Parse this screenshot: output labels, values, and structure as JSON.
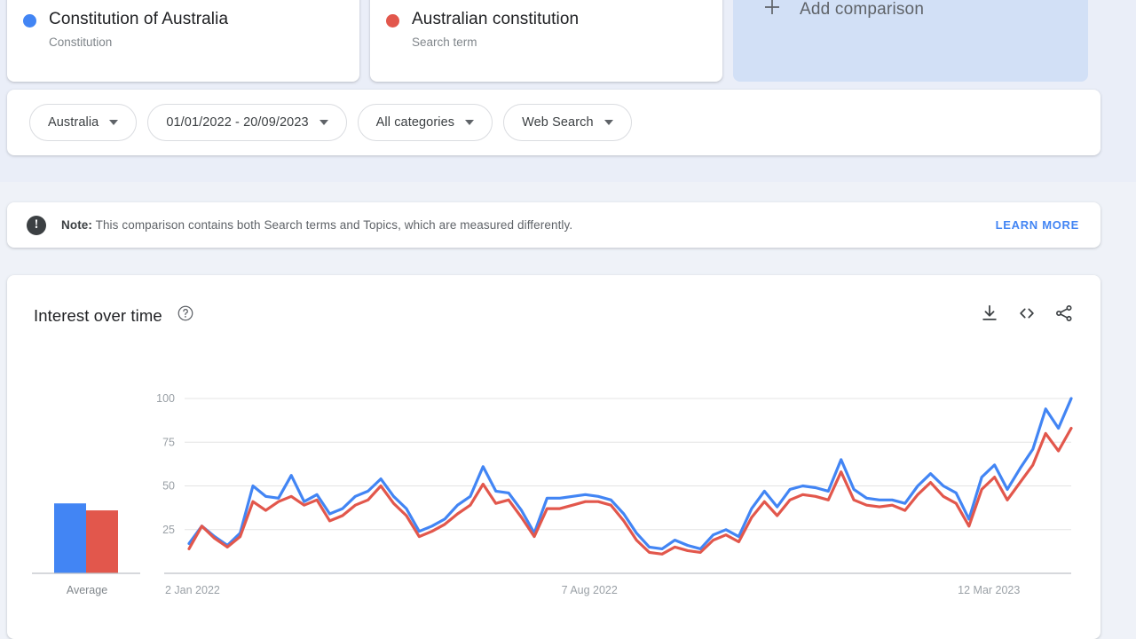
{
  "terms": [
    {
      "title": "Constitution of Australia",
      "subtitle": "Constitution",
      "color": "#4285f4",
      "dot_name": "legend-dot-blue"
    },
    {
      "title": "Australian constitution",
      "subtitle": "Search term",
      "color": "#e2574c",
      "dot_name": "legend-dot-red"
    }
  ],
  "add_comparison": {
    "label": "Add comparison",
    "icon": "plus-icon"
  },
  "filters": [
    {
      "label": "Australia",
      "name": "region-filter"
    },
    {
      "label": "01/01/2022 - 20/09/2023",
      "name": "date-range-filter"
    },
    {
      "label": "All categories",
      "name": "category-filter"
    },
    {
      "label": "Web Search",
      "name": "search-type-filter"
    }
  ],
  "note": {
    "prefix": "Note:",
    "body": " This comparison contains both Search terms and Topics, which are measured differently.",
    "learn_more": "LEARN MORE",
    "icon": "exclamation-icon"
  },
  "interest_panel": {
    "title": "Interest over time",
    "help_icon": "help-circle-icon",
    "actions": [
      {
        "name": "download-icon",
        "label": "Download"
      },
      {
        "name": "embed-code-icon",
        "label": "Embed"
      },
      {
        "name": "share-icon",
        "label": "Share"
      }
    ]
  },
  "chart_data": {
    "type": "line",
    "title": "Interest over time",
    "xlabel": "",
    "ylabel": "",
    "ylim": [
      0,
      100
    ],
    "yticks": [
      25,
      50,
      75,
      100
    ],
    "grid": true,
    "legend_position": "top-cards",
    "xtick_labels": [
      "2 Jan 2022",
      "7 Aug 2022",
      "12 Mar 2023"
    ],
    "xtick_positions": [
      0,
      31,
      62
    ],
    "x_count": 90,
    "series": [
      {
        "name": "Constitution of Australia",
        "color": "#4285f4",
        "average": 40,
        "values": [
          17,
          27,
          21,
          16,
          23,
          50,
          44,
          43,
          56,
          41,
          45,
          34,
          37,
          44,
          47,
          54,
          44,
          37,
          24,
          27,
          31,
          39,
          44,
          61,
          47,
          46,
          36,
          23,
          43,
          43,
          44,
          45,
          44,
          42,
          34,
          23,
          15,
          14,
          19,
          16,
          14,
          22,
          25,
          21,
          37,
          47,
          38,
          48,
          50,
          49,
          47,
          65,
          48,
          43,
          42,
          42,
          40,
          50,
          57,
          50,
          46,
          31,
          55,
          62,
          48,
          60,
          71,
          94,
          83,
          100
        ]
      },
      {
        "name": "Australian constitution",
        "color": "#e2574c",
        "average": 36,
        "values": [
          14,
          27,
          20,
          15,
          21,
          41,
          36,
          41,
          44,
          39,
          42,
          30,
          33,
          39,
          42,
          50,
          40,
          33,
          21,
          24,
          28,
          34,
          39,
          51,
          40,
          42,
          32,
          21,
          37,
          37,
          39,
          41,
          41,
          39,
          30,
          19,
          12,
          11,
          15,
          13,
          12,
          19,
          22,
          18,
          32,
          41,
          33,
          42,
          45,
          44,
          42,
          58,
          42,
          39,
          38,
          39,
          36,
          45,
          52,
          44,
          40,
          27,
          48,
          55,
          42,
          52,
          62,
          80,
          70,
          83
        ]
      }
    ],
    "average_bars": {
      "label": "Average",
      "bars": [
        {
          "name": "Constitution of Australia",
          "value": 40,
          "color": "#4285f4"
        },
        {
          "name": "Australian constitution",
          "value": 36,
          "color": "#e2574c"
        }
      ]
    }
  }
}
